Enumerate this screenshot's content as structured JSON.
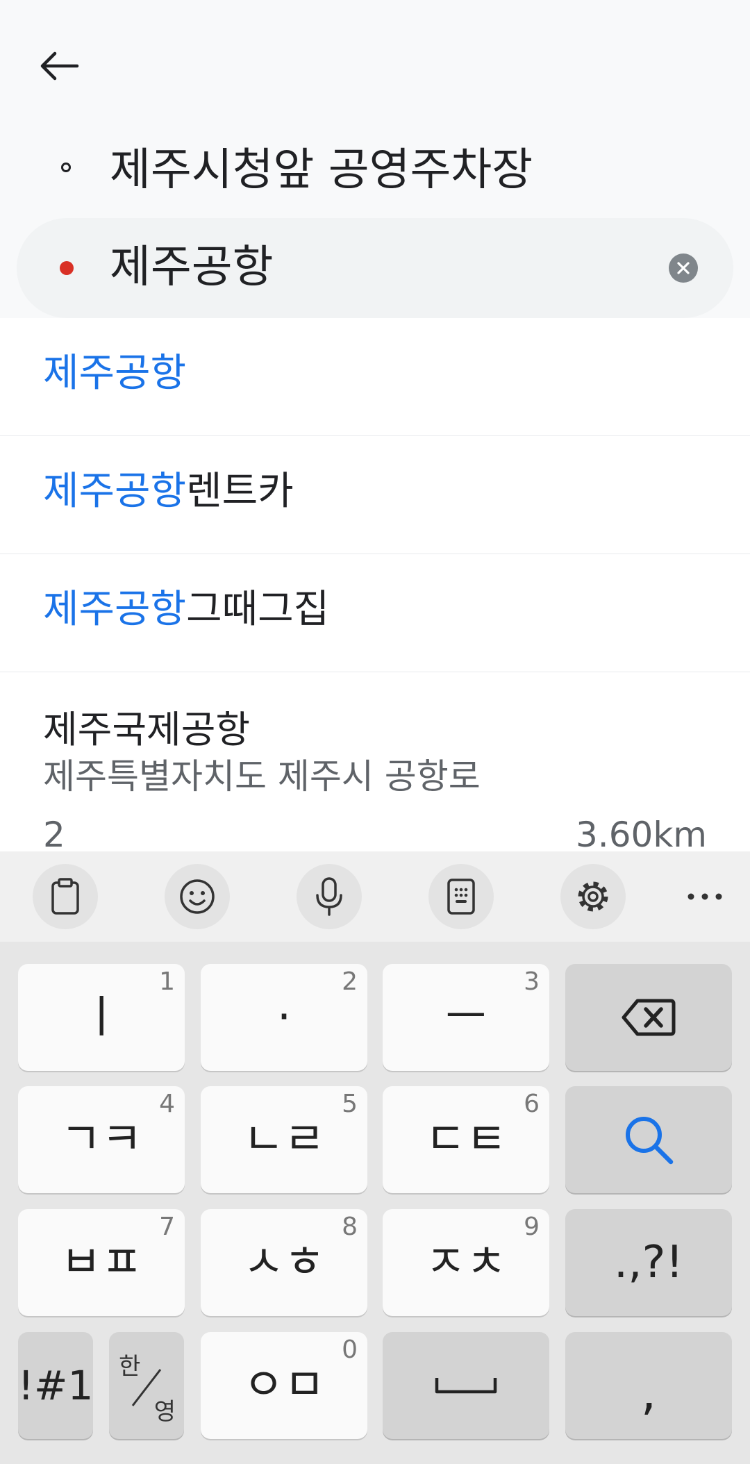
{
  "header": {
    "origin": "제주시청앞 공영주차장",
    "destination_value": "제주공항"
  },
  "suggestions": [
    {
      "highlight": "제주공항",
      "rest": ""
    },
    {
      "highlight": "제주공항",
      "rest": "렌트카"
    },
    {
      "highlight": "제주공항",
      "rest": "그때그집"
    }
  ],
  "place": {
    "name": "제주국제공항",
    "address_line1": "제주특별자치도 제주시 공항로",
    "address_line2": "2",
    "distance": "3.60km"
  },
  "keyboard": {
    "toolbar": [
      "clipboard-icon",
      "emoji-icon",
      "microphone-icon",
      "keypad-icon",
      "settings-icon",
      "more-icon"
    ],
    "rows": [
      [
        {
          "label": "ㅣ",
          "num": "1"
        },
        {
          "label": "·",
          "num": "2"
        },
        {
          "label": "ㅡ",
          "num": "3"
        }
      ],
      [
        {
          "label": "ㄱㅋ",
          "num": "4"
        },
        {
          "label": "ㄴㄹ",
          "num": "5"
        },
        {
          "label": "ㄷㅌ",
          "num": "6"
        }
      ],
      [
        {
          "label": "ㅂㅍ",
          "num": "7"
        },
        {
          "label": "ㅅㅎ",
          "num": "8"
        },
        {
          "label": "ㅈㅊ",
          "num": "9"
        }
      ]
    ],
    "punct_label": ".,?!",
    "symbols_label": "!#1",
    "lang_top": "한",
    "lang_bottom": "영",
    "om_label": "ㅇㅁ",
    "om_num": "0",
    "comma_label": ","
  },
  "colors": {
    "accent": "#1a73e8",
    "destination_dot": "#d93025"
  }
}
